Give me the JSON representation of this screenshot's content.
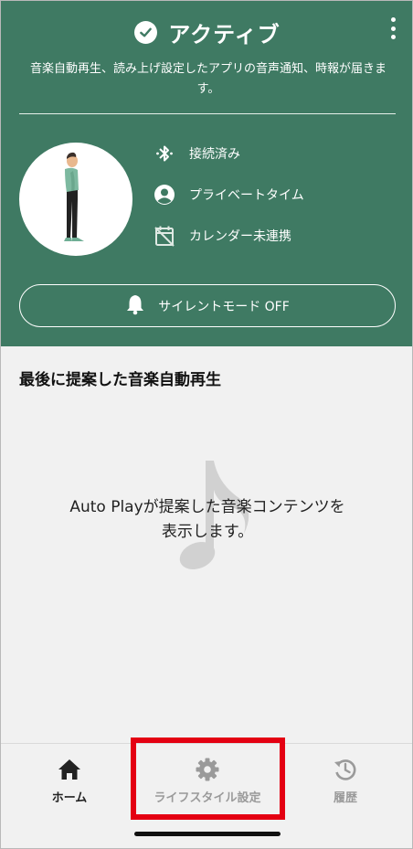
{
  "header": {
    "status_title": "アクティブ",
    "description": "音楽自動再生、読み上げ設定したアプリの音声通知、時報が届きます。",
    "info": [
      {
        "icon": "bluetooth-icon",
        "label": "接続済み"
      },
      {
        "icon": "private-time-icon",
        "label": "プライベートタイム"
      },
      {
        "icon": "calendar-off-icon",
        "label": "カレンダー未連携"
      }
    ],
    "silent_button_label": "サイレントモード OFF"
  },
  "main": {
    "section_title": "最後に提案した音楽自動再生",
    "empty_line1": "Auto Playが提案した音楽コンテンツを",
    "empty_line2": "表示します。"
  },
  "tabs": [
    {
      "icon": "home-icon",
      "label": "ホーム",
      "active": true
    },
    {
      "icon": "gear-icon",
      "label": "ライフスタイル設定",
      "active": false
    },
    {
      "icon": "history-icon",
      "label": "履歴",
      "active": false
    }
  ],
  "colors": {
    "header_bg": "#3f7a63",
    "highlight": "#e40012",
    "page_bg": "#f1f1f1"
  }
}
